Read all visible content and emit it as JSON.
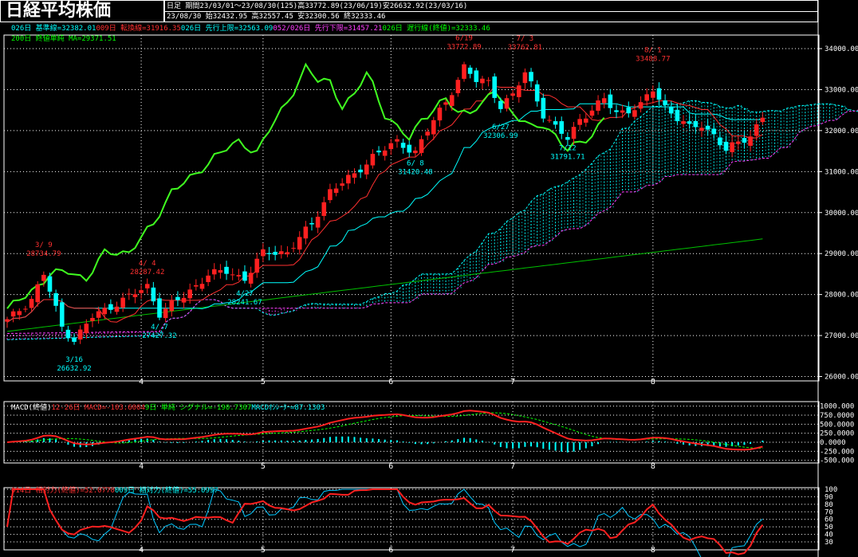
{
  "header": {
    "title": "日経平均株価",
    "period_line": "日足  期間23/03/01〜23/08/30(125)高33772.89(23/06/19)安26632.92(23/03/16)",
    "ohlc_line": "23/08/30      始32432.95 高32557.45 安32300.56 終32333.46"
  },
  "legends": {
    "main_1": [
      {
        "text": "026日 基準線=32382.01",
        "color": "#00ffff"
      },
      {
        "text": "009日 転換線=31916.35",
        "color": "#ff3030"
      },
      {
        "text": "026日 先行上限=32563.09",
        "color": "#00ffff"
      },
      {
        "text": "052/026日 先行下限=31457.21",
        "color": "#ff40ff"
      },
      {
        "text": "026日 遅行線(終値)=32333.46",
        "color": "#00ff00"
      }
    ],
    "main_2": [
      {
        "text": "200日 終値単純 MA=29371.51",
        "color": "#00ff00"
      }
    ],
    "macd": [
      {
        "text": "MACD(終値)",
        "color": "#ffffff"
      },
      {
        "text": "12-26日 MACD=-103.6004",
        "color": "#ff3030"
      },
      {
        "text": "9日 単純 シグナル=-190.7307",
        "color": "#00ff00"
      },
      {
        "text": "MACDｵｼﾚｰﾀｰ=87.1303",
        "color": "#00ffff"
      }
    ],
    "rsi": [
      {
        "text": "014日 相対力(終値)=52.0770",
        "color": "#ff3030"
      },
      {
        "text": "009日 相対力(終値)=55.0997",
        "color": "#00ffff"
      }
    ]
  },
  "chart_data": {
    "type": "candlestick",
    "x_labels": [
      "4",
      "5",
      "6",
      "7",
      "8"
    ],
    "price_axis": {
      "ylim": [
        26000,
        34500
      ],
      "ticks": [
        "34000.00",
        "33000.00",
        "32000.00",
        "31000.00",
        "30000.00",
        "29000.00",
        "28000.00",
        "27000.00",
        "26000.00"
      ]
    },
    "macd_axis": {
      "ylim": [
        -600,
        1000
      ],
      "ticks": [
        "1000.000",
        "750.0000",
        "500.0000",
        "250.0000",
        "0.0000",
        "-250.000",
        "-500.000"
      ]
    },
    "rsi_axis": {
      "ylim": [
        25,
        100
      ],
      "ticks": [
        "100",
        "90",
        "80",
        "70",
        "60",
        "50",
        "40",
        "30"
      ]
    },
    "annotations": [
      {
        "label": "3/ 9",
        "value": "28734.79",
        "color": "#ff3030",
        "bar": 6,
        "price": 28734.79,
        "pos": "above"
      },
      {
        "label": "3/16",
        "value": "26632.92",
        "color": "#00ffff",
        "bar": 11,
        "price": 26632.92,
        "pos": "below"
      },
      {
        "label": "4/ 4",
        "value": "28287.42",
        "color": "#ff3030",
        "bar": 23,
        "price": 28287.42,
        "pos": "above"
      },
      {
        "label": "4/ 7",
        "value": "27427.32",
        "color": "#00ffff",
        "bar": 25,
        "price": 27427.32,
        "pos": "below"
      },
      {
        "label": "4/27",
        "value": "28241.67",
        "color": "#00ffff",
        "bar": 39,
        "price": 28241.67,
        "pos": "below"
      },
      {
        "label": "6/ 8",
        "value": "31420.48",
        "color": "#00ffff",
        "bar": 67,
        "price": 31420.48,
        "pos": "below"
      },
      {
        "label": "6/19",
        "value": "33772.89",
        "color": "#ff3030",
        "bar": 75,
        "price": 33772.89,
        "pos": "above"
      },
      {
        "label": "6/27",
        "value": "32306.99",
        "color": "#00ffff",
        "bar": 81,
        "price": 32306.99,
        "pos": "below"
      },
      {
        "label": "7/ 3",
        "value": "33762.81",
        "color": "#ff3030",
        "bar": 85,
        "price": 33762.81,
        "pos": "above"
      },
      {
        "label": "7/12",
        "value": "31791.71",
        "color": "#00ffff",
        "bar": 92,
        "price": 31791.71,
        "pos": "below"
      },
      {
        "label": "8/ 1",
        "value": "33488.77",
        "color": "#ff3030",
        "bar": 106,
        "price": 33488.77,
        "pos": "above"
      }
    ],
    "close_anchors": [
      [
        0,
        27350
      ],
      [
        4,
        27900
      ],
      [
        6,
        28500
      ],
      [
        9,
        27200
      ],
      [
        11,
        26900
      ],
      [
        14,
        27450
      ],
      [
        18,
        27800
      ],
      [
        22,
        28100
      ],
      [
        23,
        28200
      ],
      [
        25,
        27550
      ],
      [
        29,
        27950
      ],
      [
        33,
        28500
      ],
      [
        36,
        28550
      ],
      [
        39,
        28400
      ],
      [
        42,
        29000
      ],
      [
        46,
        29050
      ],
      [
        50,
        29700
      ],
      [
        53,
        30550
      ],
      [
        57,
        30900
      ],
      [
        60,
        31400
      ],
      [
        64,
        31700
      ],
      [
        67,
        31500
      ],
      [
        69,
        32000
      ],
      [
        72,
        32700
      ],
      [
        75,
        33550
      ],
      [
        77,
        33200
      ],
      [
        79,
        33200
      ],
      [
        81,
        32600
      ],
      [
        83,
        32850
      ],
      [
        85,
        33400
      ],
      [
        86,
        33150
      ],
      [
        88,
        32400
      ],
      [
        90,
        32050
      ],
      [
        92,
        31800
      ],
      [
        94,
        32300
      ],
      [
        96,
        32500
      ],
      [
        98,
        32750
      ],
      [
        100,
        32450
      ],
      [
        102,
        32500
      ],
      [
        104,
        32600
      ],
      [
        106,
        33000
      ],
      [
        108,
        32600
      ],
      [
        110,
        32300
      ],
      [
        112,
        32050
      ],
      [
        114,
        32150
      ],
      [
        116,
        31900
      ],
      [
        118,
        31500
      ],
      [
        120,
        31700
      ],
      [
        122,
        31900
      ],
      [
        124,
        32333
      ]
    ]
  }
}
